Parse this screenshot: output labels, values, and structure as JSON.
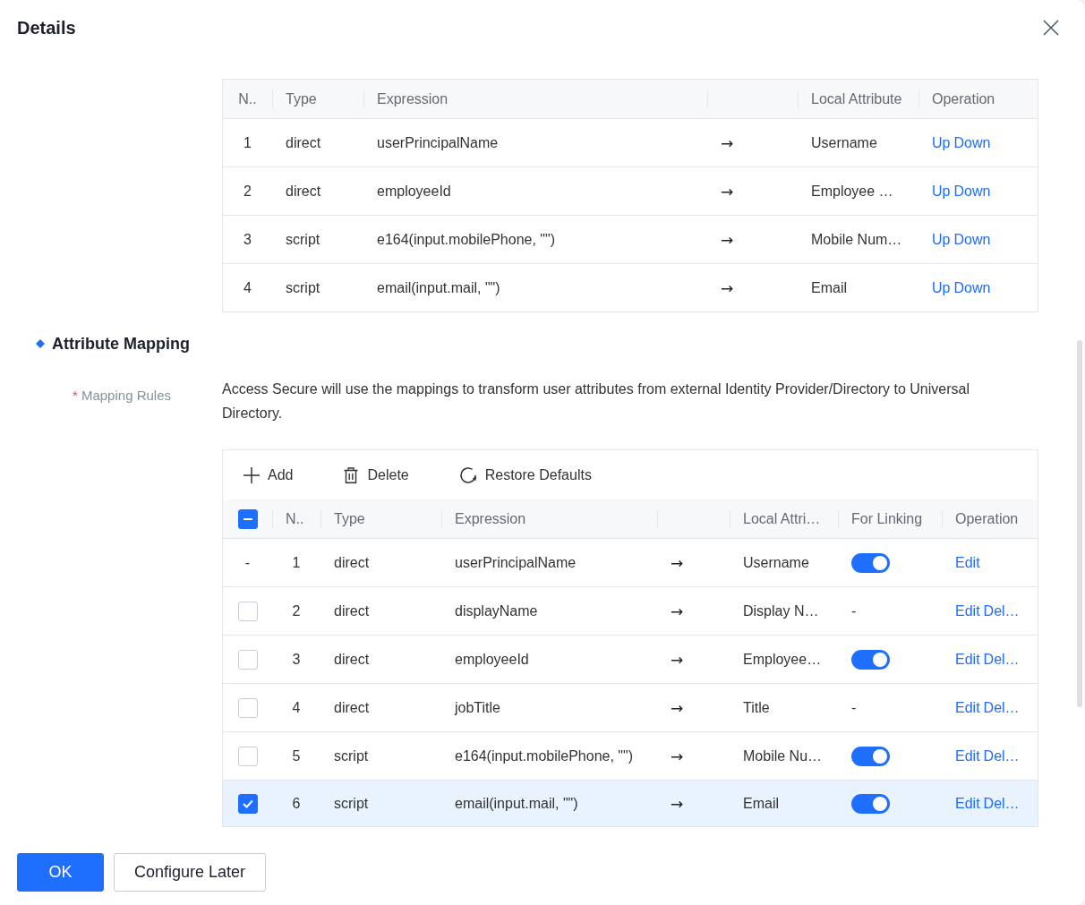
{
  "window": {
    "title": "Details"
  },
  "expression_table": {
    "columns": {
      "column_1": "N..",
      "type": "Type",
      "expression": "Expression",
      "local_attribute": "Local Attribute",
      "operation": "Operation"
    },
    "rows": [
      {
        "number": "1",
        "type": "direct",
        "expression": "userPrincipalName",
        "arrow": "→",
        "local_attribute": "Username",
        "operations": [
          "Up",
          "Down"
        ]
      },
      {
        "number": "2",
        "type": "direct",
        "expression": "employeeId",
        "arrow": "→",
        "local_attribute": "Employee …",
        "operations": [
          "Up",
          "Down"
        ]
      },
      {
        "number": "3",
        "type": "script",
        "expression": "e164(input.mobilePhone, \"\")",
        "arrow": "→",
        "local_attribute": "Mobile Num…",
        "operations": [
          "Up",
          "Down"
        ]
      },
      {
        "number": "4",
        "type": "script",
        "expression": "email(input.mail, \"\")",
        "arrow": "→",
        "local_attribute": "Email",
        "operations": [
          "Up",
          "Down"
        ]
      }
    ]
  },
  "section": {
    "title": "Attribute Mapping"
  },
  "form_item": {
    "required_mark": "*",
    "label": "Mapping Rules",
    "description": "Access Secure will use the mappings to transform user attributes from external Identity Provider/Directory to Universal Directory."
  },
  "mapping_table": {
    "toolbar": [
      {
        "kind": "add",
        "label": "Add"
      },
      {
        "kind": "delete",
        "label": "Delete"
      },
      {
        "kind": "restore",
        "label": "Restore Defaults"
      }
    ],
    "header_checkbox": {
      "indeterminate": true
    },
    "columns": {
      "column_2": "N..",
      "type": "Type",
      "expression": "Expression",
      "column_6": "Local Attri…",
      "for_linking": "For Linking",
      "operation": "Operation"
    },
    "rows": [
      {
        "kind": "fixed",
        "mark": "-",
        "checked": false,
        "number": "1",
        "type": "direct",
        "expression": "userPrincipalName",
        "arrow": "→",
        "column_6": "Username",
        "for_linking": {
          "kind": "toggle",
          "on": true
        },
        "operations": [
          "Edit"
        ]
      },
      {
        "kind": "checkbox",
        "checked": false,
        "number": "2",
        "type": "direct",
        "expression": "displayName",
        "arrow": "→",
        "column_6": "Display N…",
        "for_linking": {
          "kind": "text",
          "text": "-"
        },
        "operations": [
          "Edit",
          "Del…"
        ]
      },
      {
        "kind": "checkbox",
        "checked": false,
        "number": "3",
        "type": "direct",
        "expression": "employeeId",
        "arrow": "→",
        "column_6": "Employee…",
        "for_linking": {
          "kind": "toggle",
          "on": true
        },
        "operations": [
          "Edit",
          "Del…"
        ]
      },
      {
        "kind": "checkbox",
        "checked": false,
        "number": "4",
        "type": "direct",
        "expression": "jobTitle",
        "arrow": "→",
        "column_6": "Title",
        "for_linking": {
          "kind": "text",
          "text": "-"
        },
        "operations": [
          "Edit",
          "Del…"
        ]
      },
      {
        "kind": "checkbox",
        "checked": false,
        "number": "5",
        "type": "script",
        "expression": "e164(input.mobilePhone, \"\")",
        "arrow": "→",
        "column_6": "Mobile Nu…",
        "for_linking": {
          "kind": "toggle",
          "on": true
        },
        "operations": [
          "Edit",
          "Del…"
        ]
      },
      {
        "kind": "checkbox",
        "checked": true,
        "number": "6",
        "type": "script",
        "expression": "email(input.mail, \"\")",
        "arrow": "→",
        "column_6": "Email",
        "for_linking": {
          "kind": "toggle",
          "on": true
        },
        "operations": [
          "Edit",
          "Del…"
        ]
      }
    ]
  },
  "buttons": [
    {
      "kind": "primary",
      "label": "OK"
    },
    {
      "kind": "default",
      "label": "Configure Later"
    }
  ]
}
